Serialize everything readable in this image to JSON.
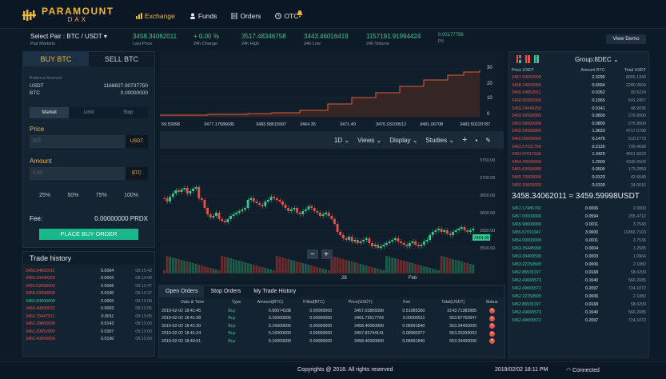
{
  "brand": {
    "name": "PARAMOUNT",
    "sub": "DAX"
  },
  "nav": {
    "exchange": "Exchange",
    "funds": "Funds",
    "orders": "Orders",
    "otc": "OTC"
  },
  "pair": {
    "label": "Select Pair :",
    "value": "BTC / USDT",
    "markets": "Pair Markets"
  },
  "stats": [
    {
      "value": "3458.34062011",
      "label": "Last Price",
      "color": "green"
    },
    {
      "value": "+ 0.00 %",
      "label": "24h Change",
      "color": "green"
    },
    {
      "value": "3517.48346758",
      "label": "24h High",
      "color": "green"
    },
    {
      "value": "3443.46016419",
      "label": "24h Low",
      "color": "green"
    },
    {
      "value": "1157191.91994424",
      "label": "24h Volume",
      "color": "green"
    },
    {
      "value": "0.00177798",
      "label": "P/L",
      "color": "green"
    }
  ],
  "view_demo": "View Demo",
  "order_form": {
    "buy_tab": "BUY BTC",
    "sell_tab": "SELL BTC",
    "balance_label": "Balance Amount",
    "usdt_label": "USDT",
    "usdt_value": "1168827.90737750",
    "btc_label": "BTC",
    "btc_value": "0.00000000",
    "types": [
      "Market",
      "Limit",
      "Stop"
    ],
    "price_label": "Price",
    "price_placeholder": "507",
    "price_unit": "USDT",
    "amount_label": "Amount",
    "amount_placeholder": "0.00",
    "amount_unit": "BTC",
    "pcts": [
      "25%",
      "50%",
      "75%",
      "100%"
    ],
    "fee_label": "Fee:",
    "fee_value": "0.00000000 PRDX",
    "button": "PLACE BUY ORDER"
  },
  "trade_history": {
    "title": "Trade history",
    "rows": [
      [
        "3458.34062011",
        "0.0004",
        "08:15:42",
        "red"
      ],
      [
        "3459.24449250",
        "0.0003",
        "08:14:08",
        "red"
      ],
      [
        "3459.59998000",
        "0.0006",
        "08:13:47",
        "red"
      ],
      [
        "3459.69998000",
        "0.0100",
        "08:13:37",
        "red"
      ],
      [
        "3460.00000000",
        "0.0003",
        "08:13:08",
        "green"
      ],
      [
        "3460.49890632",
        "0.0003",
        "08:13:05",
        "red"
      ],
      [
        "3460.70447971",
        "0.0011",
        "08:13:05",
        "red"
      ],
      [
        "3462.39800000",
        "0.0143",
        "08:13:00",
        "red"
      ],
      [
        "3462.39952999",
        "0.0307",
        "08:13:00",
        "red"
      ],
      [
        "3462.40000000",
        "0.0100",
        "08:13:00",
        "red"
      ]
    ]
  },
  "depth": {
    "prices": [
      "59.59998",
      "3477.17586685",
      "3483.58615997",
      "3464.35",
      "3471.49",
      "3476.03109512",
      "3481.06708",
      "3483.50220787"
    ],
    "yticks": [
      "30",
      "20",
      "10",
      "0"
    ]
  },
  "chart_toolbar": {
    "interval": "1D",
    "views": "Views",
    "display": "Display",
    "studies": "Studies"
  },
  "candles": {
    "yticks": [
      "3750.00",
      "3700.00",
      "3650.00",
      "3600.00",
      "3550.00",
      "3500.00"
    ],
    "xticks": [
      "28",
      "Feb"
    ],
    "last_price_tag": "3464.35"
  },
  "open_orders": {
    "tabs": [
      "Open Orders",
      "Stop Orders",
      "My Trade History"
    ],
    "headers": [
      "Date & Time",
      "Type",
      "Amount(BTC)",
      "Filled(BTC)",
      "Price(USDT)",
      "Fee",
      "Total(USDT)",
      "Status"
    ],
    "rows": [
      [
        "2019-02-02 18:41:45",
        "Buy",
        "0.90674338",
        "0.00000000",
        "3457.03808390",
        "0.51085350",
        "3143.71383985"
      ],
      [
        "2019-02-02 18:41:38",
        "Buy",
        "0.16000000",
        "0.00000000",
        "3461.73517793",
        "0.09000511",
        "553.87762847"
      ],
      [
        "2019-02-02 18:41:30",
        "Buy",
        "0.16000000",
        "0.00000000",
        "3458.40000000",
        "0.08991840",
        "553.34400000"
      ],
      [
        "2019-02-02 18:41:24",
        "Buy",
        "0.16000000",
        "0.00000000",
        "3457.83744141",
        "0.08990377",
        "553.25399063"
      ],
      [
        "2019-02-02 18:40:51",
        "Buy",
        "0.16000000",
        "0.00000000",
        "3458.40000000",
        "0.08991840",
        "553.34400000"
      ]
    ]
  },
  "order_book": {
    "group": "Group:8DEC",
    "headers": [
      "Price USDT",
      "Amount BTC",
      "Total USDT"
    ],
    "asks": [
      [
        "3457.94059000",
        "2.3295",
        "8055.1343"
      ],
      [
        "3458.24059999",
        "0.6594",
        "2280.3604"
      ],
      [
        "3458.34062011",
        "0.0262",
        "90.5224"
      ],
      [
        "3458.65982000",
        "0.1565",
        "541.2457"
      ],
      [
        "3459.24449250",
        "0.0141",
        "48.9036"
      ],
      [
        "3459.99999989",
        "0.0800",
        "276.8000"
      ],
      [
        "3459.99999998",
        "0.0800",
        "276.8000"
      ],
      [
        "3459.99999999",
        "1.3633",
        "4717.0789"
      ],
      [
        "3460.00000000",
        "0.1475",
        "510.1773"
      ],
      [
        "3462.57021788",
        "0.2135",
        "739.4699"
      ],
      [
        "3463.97017938",
        "1.3429",
        "4651.5023"
      ],
      [
        "3464.20000000",
        "1.2500",
        "4330.2500"
      ],
      [
        "3465.69999998",
        "0.0500",
        "173.2850"
      ],
      [
        "3465.70000000",
        "0.0123",
        "42.5640"
      ],
      [
        "3466.10000000",
        "0.0100",
        "34.6610"
      ]
    ],
    "mid_left": "3458.34062011",
    "mid_sep": "≈",
    "mid_right": "3459.59998USDT",
    "bids": [
      [
        "3457.17486702",
        "0.0006",
        "2.0000"
      ],
      [
        "3457.00000000",
        "0.0594",
        "205.4712"
      ],
      [
        "3455.98000000",
        "0.0011",
        "3.7543"
      ],
      [
        "3455.57011047",
        "3.0000",
        "10366.7103"
      ],
      [
        "3454.00000000",
        "0.0011",
        "3.7536"
      ],
      [
        "3453.35445990",
        "0.0004",
        "1.2585"
      ],
      [
        "3453.30409590",
        "0.0003",
        "1.0964"
      ],
      [
        "3453.22750590",
        "0.0006",
        "2.1882"
      ],
      [
        "3452.86531197",
        "0.0168",
        "58.0209"
      ],
      [
        "3452.49065573",
        "0.1640",
        "566.2085"
      ],
      [
        "3452.49065572",
        "0.2097",
        "724.1072"
      ],
      [
        "3452.22750590",
        "0.0006",
        "2.1882"
      ],
      [
        "3452.86531197",
        "0.0168",
        "58.0209"
      ],
      [
        "3452.49065573",
        "0.1640",
        "566.2085"
      ],
      [
        "3452.49065572",
        "0.2097",
        "724.1072"
      ]
    ]
  },
  "footer": {
    "copyright": "Copyrights @ 2018. All rights reserved",
    "datetime": "2019/02/02 18:11 PM",
    "status": "Connected"
  }
}
